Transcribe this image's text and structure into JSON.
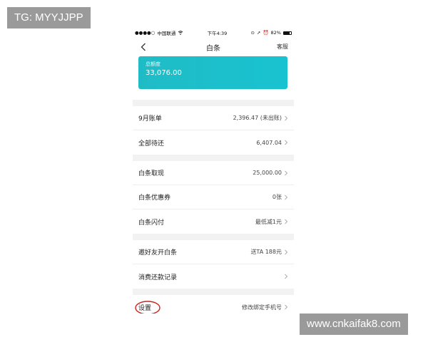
{
  "watermarks": {
    "top_left": "TG: MYYJJPP",
    "bottom_right": "www.cnkaifak8.com"
  },
  "status_bar": {
    "signal": "●●●●○",
    "carrier": "中国联通",
    "wifi_icon": "wifi-icon",
    "time": "下午4:39",
    "battery": "82%"
  },
  "nav": {
    "title": "白条",
    "right_label": "客服"
  },
  "card": {
    "label": "总额度",
    "amount": "33,076.00",
    "color": "#1ec0ca"
  },
  "groups": [
    {
      "rows": [
        {
          "title": "9月账单",
          "value": "2,396.47 (未出账)"
        },
        {
          "title": "全部待还",
          "value": "6,407.04"
        }
      ]
    },
    {
      "rows": [
        {
          "title": "白条取现",
          "value": "25,000.00"
        },
        {
          "title": "白条优惠券",
          "value": "0张"
        },
        {
          "title": "白条闪付",
          "value": "最低减1元"
        }
      ]
    },
    {
      "rows": [
        {
          "title": "邀好友开白条",
          "value": "送TA 188元"
        },
        {
          "title": "消费还款记录",
          "value": ""
        }
      ]
    },
    {
      "rows": [
        {
          "title": "设置",
          "value": "修改绑定手机号"
        }
      ]
    }
  ],
  "annotation_color": "#cc2222"
}
